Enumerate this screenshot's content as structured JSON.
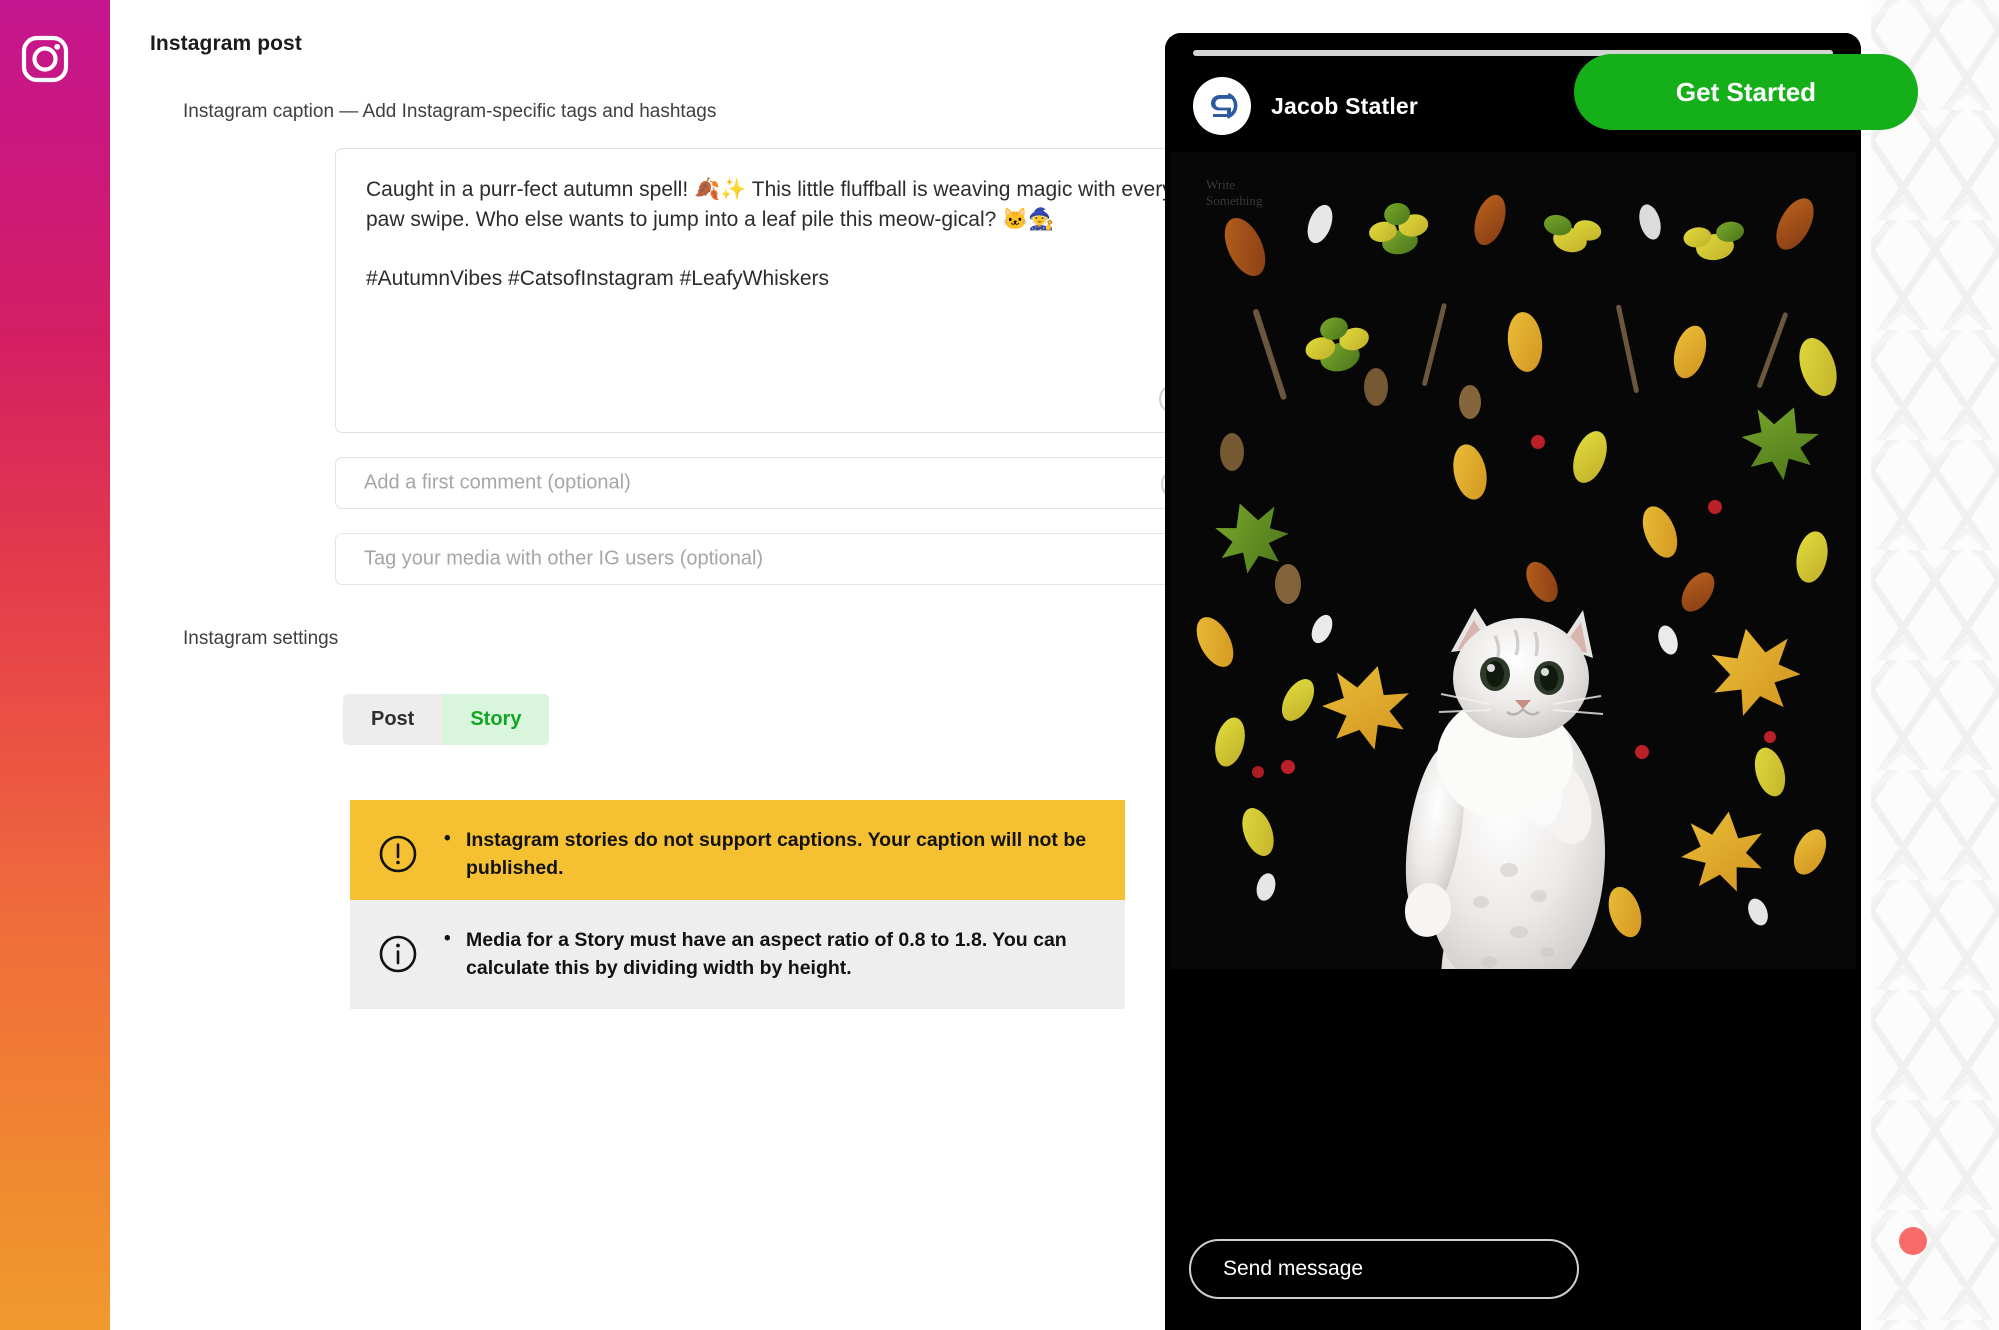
{
  "sidebar": {
    "icon": "instagram-logo-icon",
    "gradient_from": "#c4168f",
    "gradient_to": "#f09a2d"
  },
  "form": {
    "title": "Instagram post",
    "caption_label": "Instagram caption — Add Instagram-specific tags and hashtags",
    "caption_value": "Caught in a purr-fect autumn spell! 🍂✨ This little fluffball is weaving magic with every paw swipe. Who else wants to jump into a leaf pile this meow-gical? 🐱🧙\n\n#AutumnVibes #CatsofInstagram #LeafyWhiskers",
    "comment_placeholder": "Add a first comment (optional)",
    "tag_placeholder": "Tag your media with other IG users (optional)",
    "settings_label": "Instagram settings",
    "emoji_icon": "smiley-face-icon",
    "resize_icon": "resize-grip-icon"
  },
  "segmented": {
    "options": [
      {
        "label": "Post",
        "active": false
      },
      {
        "label": "Story",
        "active": true
      }
    ],
    "active_color": "#13a527",
    "active_bg": "#d9f5dc",
    "inactive_bg": "#ededed"
  },
  "alerts": [
    {
      "type": "warning",
      "icon": "exclamation-circle-icon",
      "text": "Instagram stories do not support captions. Your caption will not be published.",
      "bg": "#f5c133"
    },
    {
      "type": "info",
      "icon": "info-circle-icon",
      "text": "Media for a Story must have an aspect ratio of 0.8 to 1.8. You can calculate this by dividing width by height.",
      "bg": "#eeeeee"
    }
  ],
  "preview": {
    "username": "Jacob Statler",
    "avatar_icon": "profile-logo-icon",
    "watermark": "Write\nSomething",
    "send_message_placeholder": "Send message",
    "cta_label": "Get Started",
    "cta_color": "#15b019",
    "notification_dot_color": "#f96a6a",
    "progress_color": "#d4d4d4"
  }
}
